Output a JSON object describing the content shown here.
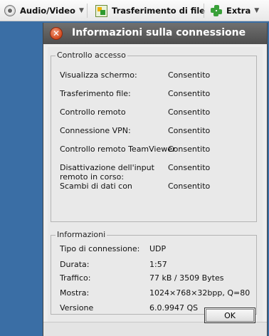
{
  "toolbar": {
    "items": [
      {
        "label": "Audio/Video",
        "icon": "audio-video-icon",
        "arrow": "▼"
      },
      {
        "label": "Trasferimento di file",
        "icon": "file-transfer-icon"
      },
      {
        "label": "Extra",
        "icon": "extra-puzzle-icon",
        "arrow": "▼"
      }
    ]
  },
  "dialog": {
    "title": "Informazioni sulla connessione",
    "close_glyph": "✕",
    "ok_label": "OK"
  },
  "access": {
    "legend": "Controllo accesso",
    "rows": [
      {
        "label": "Visualizza schermo:",
        "value": "Consentito"
      },
      {
        "label": "Trasferimento file:",
        "value": "Consentito"
      },
      {
        "label": "Controllo remoto",
        "value": "Consentito"
      },
      {
        "label": "Connessione VPN:",
        "value": "Consentito"
      },
      {
        "label": "Controllo remoto TeamViewer",
        "value": "Consentito"
      },
      {
        "label": "Disattivazione dell'input\nremoto in corso:",
        "value": "Consentito"
      },
      {
        "label": "Scambi di dati con",
        "value": "Consentito"
      }
    ]
  },
  "info": {
    "legend": "Informazioni",
    "rows": [
      {
        "label": "Tipo di connessione:",
        "value": "UDP"
      },
      {
        "label": "Durata:",
        "value": "1:57"
      },
      {
        "label": "Traffico:",
        "value": "77 kB / 3509 Bytes"
      },
      {
        "label": "Mostra:",
        "value": "1024×768×32bpp, Q=80"
      },
      {
        "label": "Versione",
        "value": "6.0.9947 QS"
      }
    ]
  },
  "colors": {
    "desktop": "#3a6ea5",
    "titlebar": "#5a5a5a",
    "close_button": "#d24a1e"
  }
}
